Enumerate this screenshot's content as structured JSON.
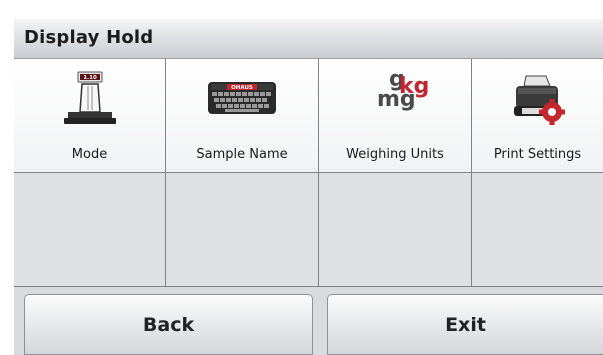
{
  "header": {
    "title": "Display Hold"
  },
  "menu": {
    "items": [
      {
        "label": "Mode",
        "icon": "scale-mode-icon",
        "display_text": "1.10"
      },
      {
        "label": "Sample Name",
        "icon": "keyboard-icon",
        "brand_text": "OHAUS"
      },
      {
        "label": "Weighing Units",
        "icon": "weighing-units-icon",
        "units": [
          "g",
          "kg",
          "mg"
        ]
      },
      {
        "label": "Print Settings",
        "icon": "printer-settings-icon"
      }
    ]
  },
  "footer": {
    "back_label": "Back",
    "exit_label": "Exit"
  },
  "colors": {
    "accent_red": "#c2262e",
    "header_bg": "#dcdfe2",
    "empty_cell": "#dfe0e2"
  }
}
